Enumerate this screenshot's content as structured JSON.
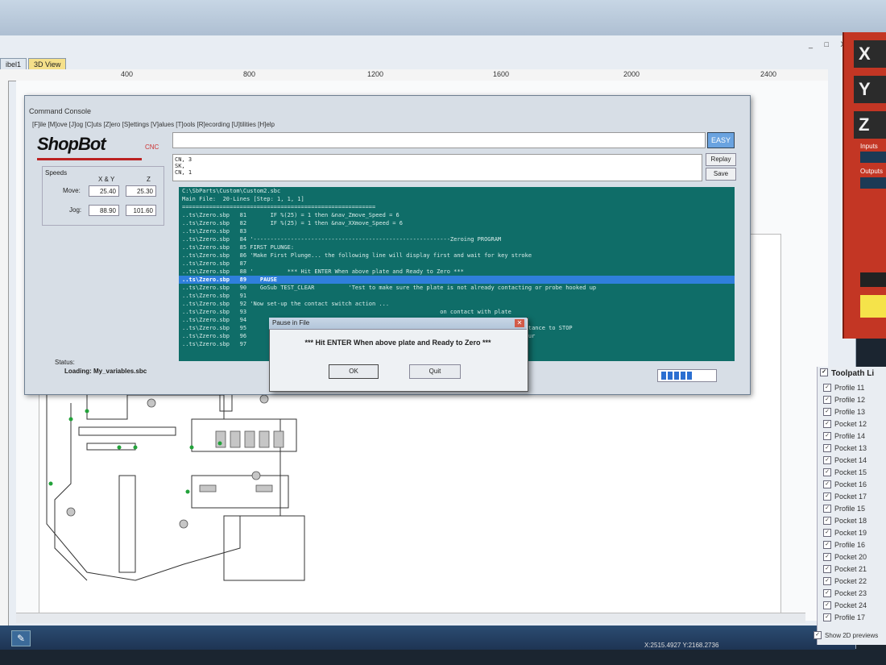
{
  "tabs": [
    {
      "label": "ibel1"
    },
    {
      "label": "3D View"
    }
  ],
  "ruler": {
    "marks": [
      "400",
      "800",
      "1200",
      "1600",
      "2000",
      "2400"
    ]
  },
  "statusbar": {
    "coords": "X:2515.4927 Y:2168.2736"
  },
  "dro": {
    "axes": [
      "X",
      "Y",
      "Z"
    ],
    "inputs_label": "Inputs",
    "outputs_label": "Outputs"
  },
  "toolpaths": {
    "header": "Toolpath Li",
    "items": [
      "Profile 11",
      "Profile 12",
      "Profile 13",
      "Pocket 12",
      "Profile 14",
      "Pocket 13",
      "Pocket 14",
      "Pocket 15",
      "Pocket 16",
      "Pocket 17",
      "Profile 15",
      "Pocket 18",
      "Pocket 19",
      "Profile 16",
      "Pocket 20",
      "Pocket 21",
      "Pocket 22",
      "Pocket 23",
      "Pocket 24",
      "Profile 17"
    ],
    "show_2d": "Show 2D previews"
  },
  "console": {
    "title": "Command Console",
    "menu": "[F]ile  [M]ove  [J]og  [C]uts  [Z]ero  [S]ettings  [V]alues  [T]ools  [R]ecording  [U]tilities  [H]elp",
    "logo": "ShopBot",
    "logo_sub": "CNC",
    "easy_label": "EASY",
    "replay_label": "Replay",
    "save_label": "Save",
    "history": [
      "CN, 3",
      "SK,",
      "CN, 1"
    ],
    "speeds": {
      "title": "Speeds",
      "col_xy": "X & Y",
      "col_z": "Z",
      "move_label": "Move:",
      "jog_label": "Jog:",
      "move_xy": "25.40",
      "move_z": "25.30",
      "jog_xy": "88.90",
      "jog_z": "101.60"
    },
    "status_label": "Status:",
    "status_value": "Loading: My_variables.sbc",
    "progress": 0.5,
    "code_lines": [
      "C:\\SbParts\\Custom\\Custom2.sbc",
      "Main File:  20-Lines [Step: 1, 1, 1]",
      "=========================================================",
      "..ts\\Zzero.sbp   81       IF %(25) = 1 then &nav_Zmove_Speed = 6",
      "..ts\\Zzero.sbp   82       IF %(25) = 1 then &nav_XXmove_Speed = 6",
      "..ts\\Zzero.sbp   83",
      "..ts\\Zzero.sbp   84 '----------------------------------------------------------Zeroing PROGRAM",
      "..ts\\Zzero.sbp   85 FIRST PLUNGE:",
      "..ts\\Zzero.sbp   86 'Make First Plunge... the following line will display first and wait for key stroke",
      "..ts\\Zzero.sbp   87",
      "..ts\\Zzero.sbp   88 '          *** Hit ENTER When above plate and Ready to Zero ***",
      "..ts\\Zzero.sbp   89    PAUSE",
      "..ts\\Zzero.sbp   90    GoSub TEST_CLEAR          'Test to make sure the plate is not already contacting or probe hooked up",
      "..ts\\Zzero.sbp   91",
      "..ts\\Zzero.sbp   92 'Now set-up the contact switch action ...",
      "..ts\\Zzero.sbp   93                                                         on contact with plate",
      "..ts\\Zzero.sbp   94",
      "..ts\\Zzero.sbp   95                                                         reduce packet size and distance to STOP",
      "..ts\\Zzero.sbp   96                                                         looking for contact to occur",
      "..ts\\Zzero.sbp   97"
    ],
    "highlight_index": 11
  },
  "pause_dialog": {
    "title": "Pause in File",
    "message": "*** Hit ENTER When above plate and Ready to Zero ***",
    "ok_label": "OK",
    "quit_label": "Quit"
  },
  "window_controls": "_ □ X"
}
